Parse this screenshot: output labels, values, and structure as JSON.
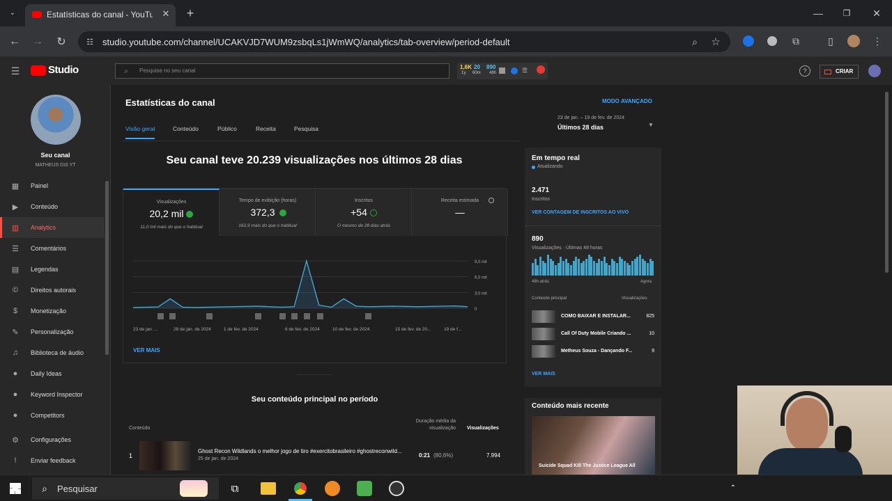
{
  "browser": {
    "tab_title": "Estatísticas do canal - YouTube",
    "url": "studio.youtube.com/channel/UCAKVJD7WUM9zsbqLs1jWmWQ/analytics/tab-overview/period-default"
  },
  "header": {
    "logo": "Studio",
    "search_placeholder": "Pesquise no seu canal",
    "ext_badges": [
      "1,6K",
      "20",
      "890"
    ],
    "ext_sub": [
      "1y",
      "60m",
      "48h"
    ],
    "create": "CRIAR"
  },
  "channel": {
    "title": "Seu canal",
    "name": "MATHEUS 016 YT"
  },
  "sidebar": {
    "items": [
      {
        "label": "Painel",
        "icon": "▦"
      },
      {
        "label": "Conteúdo",
        "icon": "▶"
      },
      {
        "label": "Analytics",
        "icon": "▥"
      },
      {
        "label": "Comentários",
        "icon": "☰"
      },
      {
        "label": "Legendas",
        "icon": "▤"
      },
      {
        "label": "Direitos autorais",
        "icon": "©"
      },
      {
        "label": "Monetização",
        "icon": "$"
      },
      {
        "label": "Personalização",
        "icon": "✎"
      },
      {
        "label": "Biblioteca de áudio",
        "icon": "♫"
      },
      {
        "label": "Daily Ideas",
        "icon": "●"
      },
      {
        "label": "Keyword Inspector",
        "icon": "●"
      },
      {
        "label": "Competitors",
        "icon": "●"
      },
      {
        "label": "Configurações",
        "icon": "⚙"
      },
      {
        "label": "Enviar feedback",
        "icon": "!"
      }
    ]
  },
  "page": {
    "title": "Estatísticas do canal",
    "advanced": "MODO AVANÇADO",
    "tabs": [
      "Visão geral",
      "Conteúdo",
      "Público",
      "Receita",
      "Pesquisa"
    ],
    "period_range": "23 de jan. – 19 de fev. de 2024",
    "period": "Últimos 28 dias",
    "headline": "Seu canal teve 20.239 visualizações nos últimos 28 dias"
  },
  "metrics": [
    {
      "label": "Visualizações",
      "value": "20,2 mil",
      "sub": "11,0 mil mais do que o habitual"
    },
    {
      "label": "Tempo de exibição (horas)",
      "value": "372,3",
      "sub": "162,9 mais do que o habitual"
    },
    {
      "label": "Inscritos",
      "value": "+54",
      "sub": "O mesmo de 28 dias atrás"
    },
    {
      "label": "Receita estimada",
      "value": "—",
      "sub": ""
    }
  ],
  "chart_data": {
    "type": "line",
    "x": [
      "23 de jan. ...",
      "28 de jan. de 2024",
      "1 de fev. de 2024",
      "6 de fev. de 2024",
      "10 de fev. de 2024",
      "15 de fev. de 20...",
      "19 de f..."
    ],
    "values": [
      150,
      200,
      250,
      1800,
      200,
      150,
      200,
      250,
      300,
      350,
      400,
      300,
      200,
      300,
      9000,
      600,
      200,
      1800,
      400,
      300,
      350,
      400,
      350,
      300,
      350,
      400,
      450,
      300
    ],
    "yticks": [
      "9,0 mil",
      "6,0 mil",
      "3,0 mil",
      "0"
    ],
    "ylim": [
      0,
      9000
    ]
  },
  "ver_mais": "VER MAIS",
  "top_content": {
    "title": "Seu conteúdo principal no período",
    "col_content": "Conteúdo",
    "col_duration": "Duração média da visualização",
    "col_views": "Visualizações",
    "rows": [
      {
        "rank": "1",
        "title": "Ghost Recon Wildlands o melhor jogo de tiro #exercitobrasileiro #ghostreconwild...",
        "date": "25 de jan. de 2024",
        "duration": "0:21",
        "pct": "(80,6%)",
        "views": "7.994"
      }
    ]
  },
  "realtime": {
    "title": "Em tempo real",
    "status": "Atualizando",
    "subs": "2.471",
    "subs_label": "Inscritos",
    "live_link": "VER CONTAGEM DE INSCRITOS AO VIVO",
    "views": "890",
    "views_label": "Visualizações · Últimas 48 horas",
    "bars": [
      6,
      8,
      5,
      9,
      7,
      6,
      10,
      8,
      7,
      5,
      6,
      9,
      7,
      8,
      6,
      5,
      7,
      9,
      8,
      6,
      7,
      8,
      10,
      9,
      7,
      6,
      8,
      7,
      9,
      6,
      5,
      8,
      7,
      6,
      9,
      8,
      7,
      6,
      5,
      7,
      8,
      9,
      10,
      8,
      7,
      6,
      8,
      7
    ],
    "start": "48h atrás",
    "end": "Agora",
    "col_content": "Conteúdo principal",
    "col_views": "Visualizações",
    "items": [
      {
        "title": "COMO BAIXAR E INSTALAR...",
        "views": "825"
      },
      {
        "title": "Call Of Duty Mobile Criando ...",
        "views": "10"
      },
      {
        "title": "Metheus Souza - Dançando F...",
        "views": "9"
      }
    ],
    "ver_mais": "VER MAIS"
  },
  "recent": {
    "title": "Conteúdo mais recente",
    "video_title": "Suicide Squad Kill The Justice League All"
  },
  "taskbar": {
    "search": "Pesquisar"
  }
}
